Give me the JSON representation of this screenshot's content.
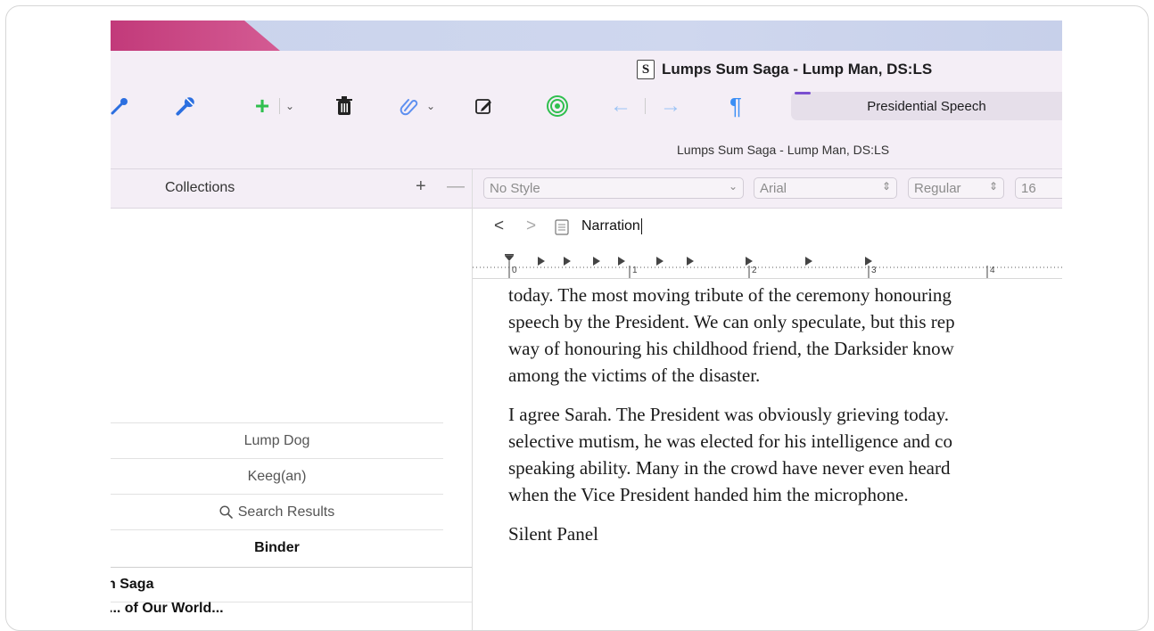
{
  "window": {
    "title": "Lumps Sum Saga - Lump Man, DS:LS",
    "subtitle": "Lumps Sum Saga - Lump Man, DS:LS",
    "doc_icon_letter": "S"
  },
  "toolbar": {
    "icons": [
      "eyedropper-icon",
      "eyedropper-icon",
      "add-icon",
      "trash-icon",
      "paperclip-icon",
      "compose-icon",
      "target-icon",
      "arrow-left-icon",
      "arrow-right-icon",
      "pilcrow-icon"
    ],
    "active_doc_label": "Presidential Speech"
  },
  "collections": {
    "header": "Collections",
    "add_label": "+",
    "remove_label": "—",
    "items": [
      {
        "label": "Lump Dog"
      },
      {
        "label": "Keeg(an)"
      },
      {
        "label": "Search Results",
        "icon": "search-icon"
      },
      {
        "label": "Binder"
      }
    ]
  },
  "binder": {
    "rows": [
      "n Saga",
      "... of Our World..."
    ]
  },
  "format_bar": {
    "style": "No Style",
    "font": "Arial",
    "weight": "Regular",
    "size": "16"
  },
  "navigation": {
    "back": "<",
    "forward": ">",
    "doc_title": "Narration"
  },
  "ruler": {
    "labels": [
      "0",
      "1",
      "2",
      "3",
      "4"
    ]
  },
  "document": {
    "paragraphs": [
      [
        "today. The most moving tribute of the ceremony honouring",
        "speech by the President. We can only speculate, but this rep",
        "way of honouring his childhood friend, the Darksider know",
        "among the victims of the disaster."
      ],
      [
        "I agree Sarah. The President was obviously grieving today.",
        "selective mutism, he was elected for his intelligence and co",
        "speaking ability. Many in the crowd have never even heard",
        "when the Vice President handed him the microphone."
      ],
      [
        "Silent Panel"
      ]
    ]
  },
  "colors": {
    "accent_green": "#2fbf4e",
    "accent_blue": "#2c6fe0",
    "pilcrow_blue": "#3a8ef5",
    "chrome": "#f4eef6"
  }
}
